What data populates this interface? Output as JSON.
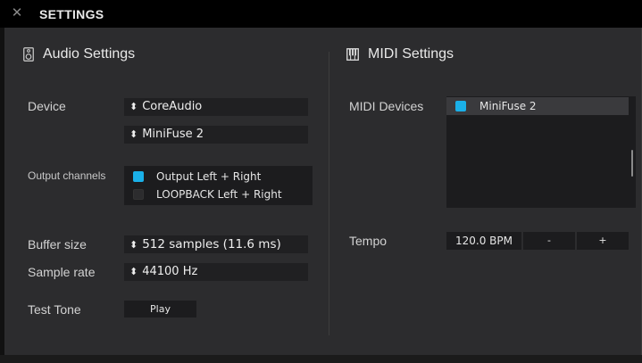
{
  "window": {
    "title": "SETTINGS",
    "close_icon": "close-icon"
  },
  "audio": {
    "title": "Audio Settings",
    "icon": "speaker-icon",
    "device_label": "Device",
    "device_driver": "CoreAudio",
    "device_interface": "MiniFuse 2",
    "output_channels_label": "Output channels",
    "output_channels": [
      {
        "label": "Output Left + Right",
        "checked": true
      },
      {
        "label": "LOOPBACK Left + Right",
        "checked": false
      }
    ],
    "buffer_size_label": "Buffer size",
    "buffer_size_value": "512 samples (11.6 ms)",
    "sample_rate_label": "Sample rate",
    "sample_rate_value": "44100 Hz",
    "test_tone_label": "Test Tone",
    "play_label": "Play"
  },
  "midi": {
    "title": "MIDI Settings",
    "icon": "piano-keys-icon",
    "devices_label": "MIDI Devices",
    "devices": [
      {
        "label": "MiniFuse 2",
        "checked": true
      }
    ],
    "tempo_label": "Tempo",
    "tempo_value": "120.0 BPM",
    "decrement_label": "-",
    "increment_label": "+"
  },
  "colors": {
    "accent": "#1ab0e8",
    "panel": "#2c2c2e",
    "field": "#202022",
    "titlebar": "#000000"
  }
}
